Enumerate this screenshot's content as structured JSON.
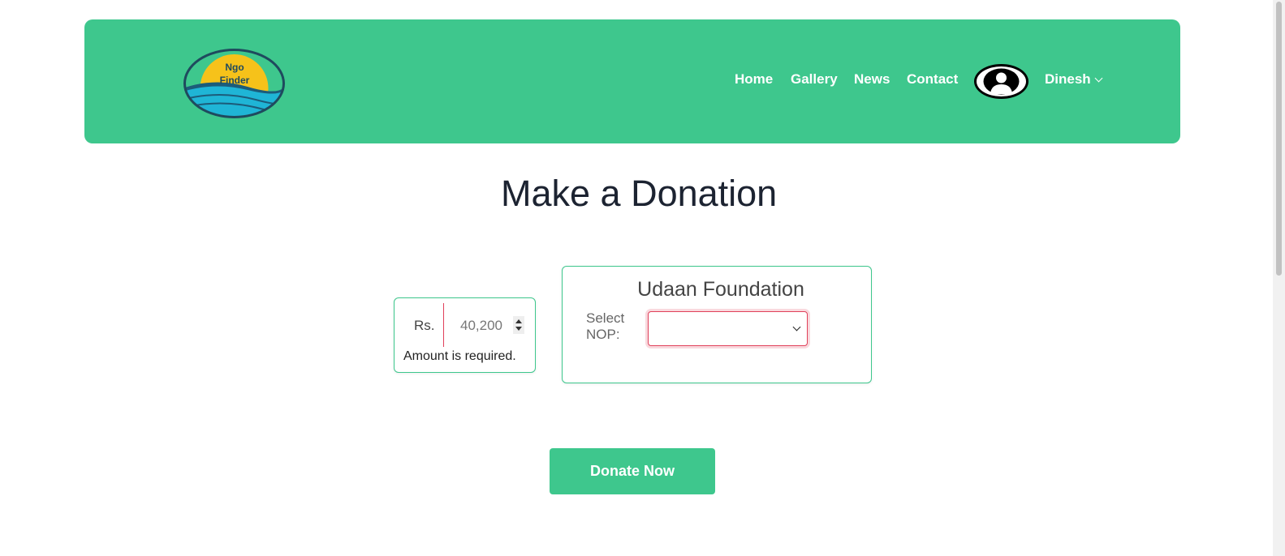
{
  "brand": {
    "logo_line1": "Ngo",
    "logo_line2": "Finder"
  },
  "nav": {
    "items": [
      {
        "label": "Home"
      },
      {
        "label": "Gallery"
      },
      {
        "label": "News"
      },
      {
        "label": "Contact"
      }
    ],
    "user_name": "Dinesh"
  },
  "page": {
    "title": "Make a Donation"
  },
  "amount": {
    "currency_label": "Rs.",
    "value": "40,200",
    "error": "Amount is required."
  },
  "organization": {
    "name": "Udaan Foundation",
    "nop_label": "Select NOP:",
    "nop_selected": ""
  },
  "actions": {
    "donate_label": "Donate Now"
  },
  "colors": {
    "accent": "#3ec78d",
    "title_underline": "#a7e6ca",
    "error": "#e0405a"
  }
}
